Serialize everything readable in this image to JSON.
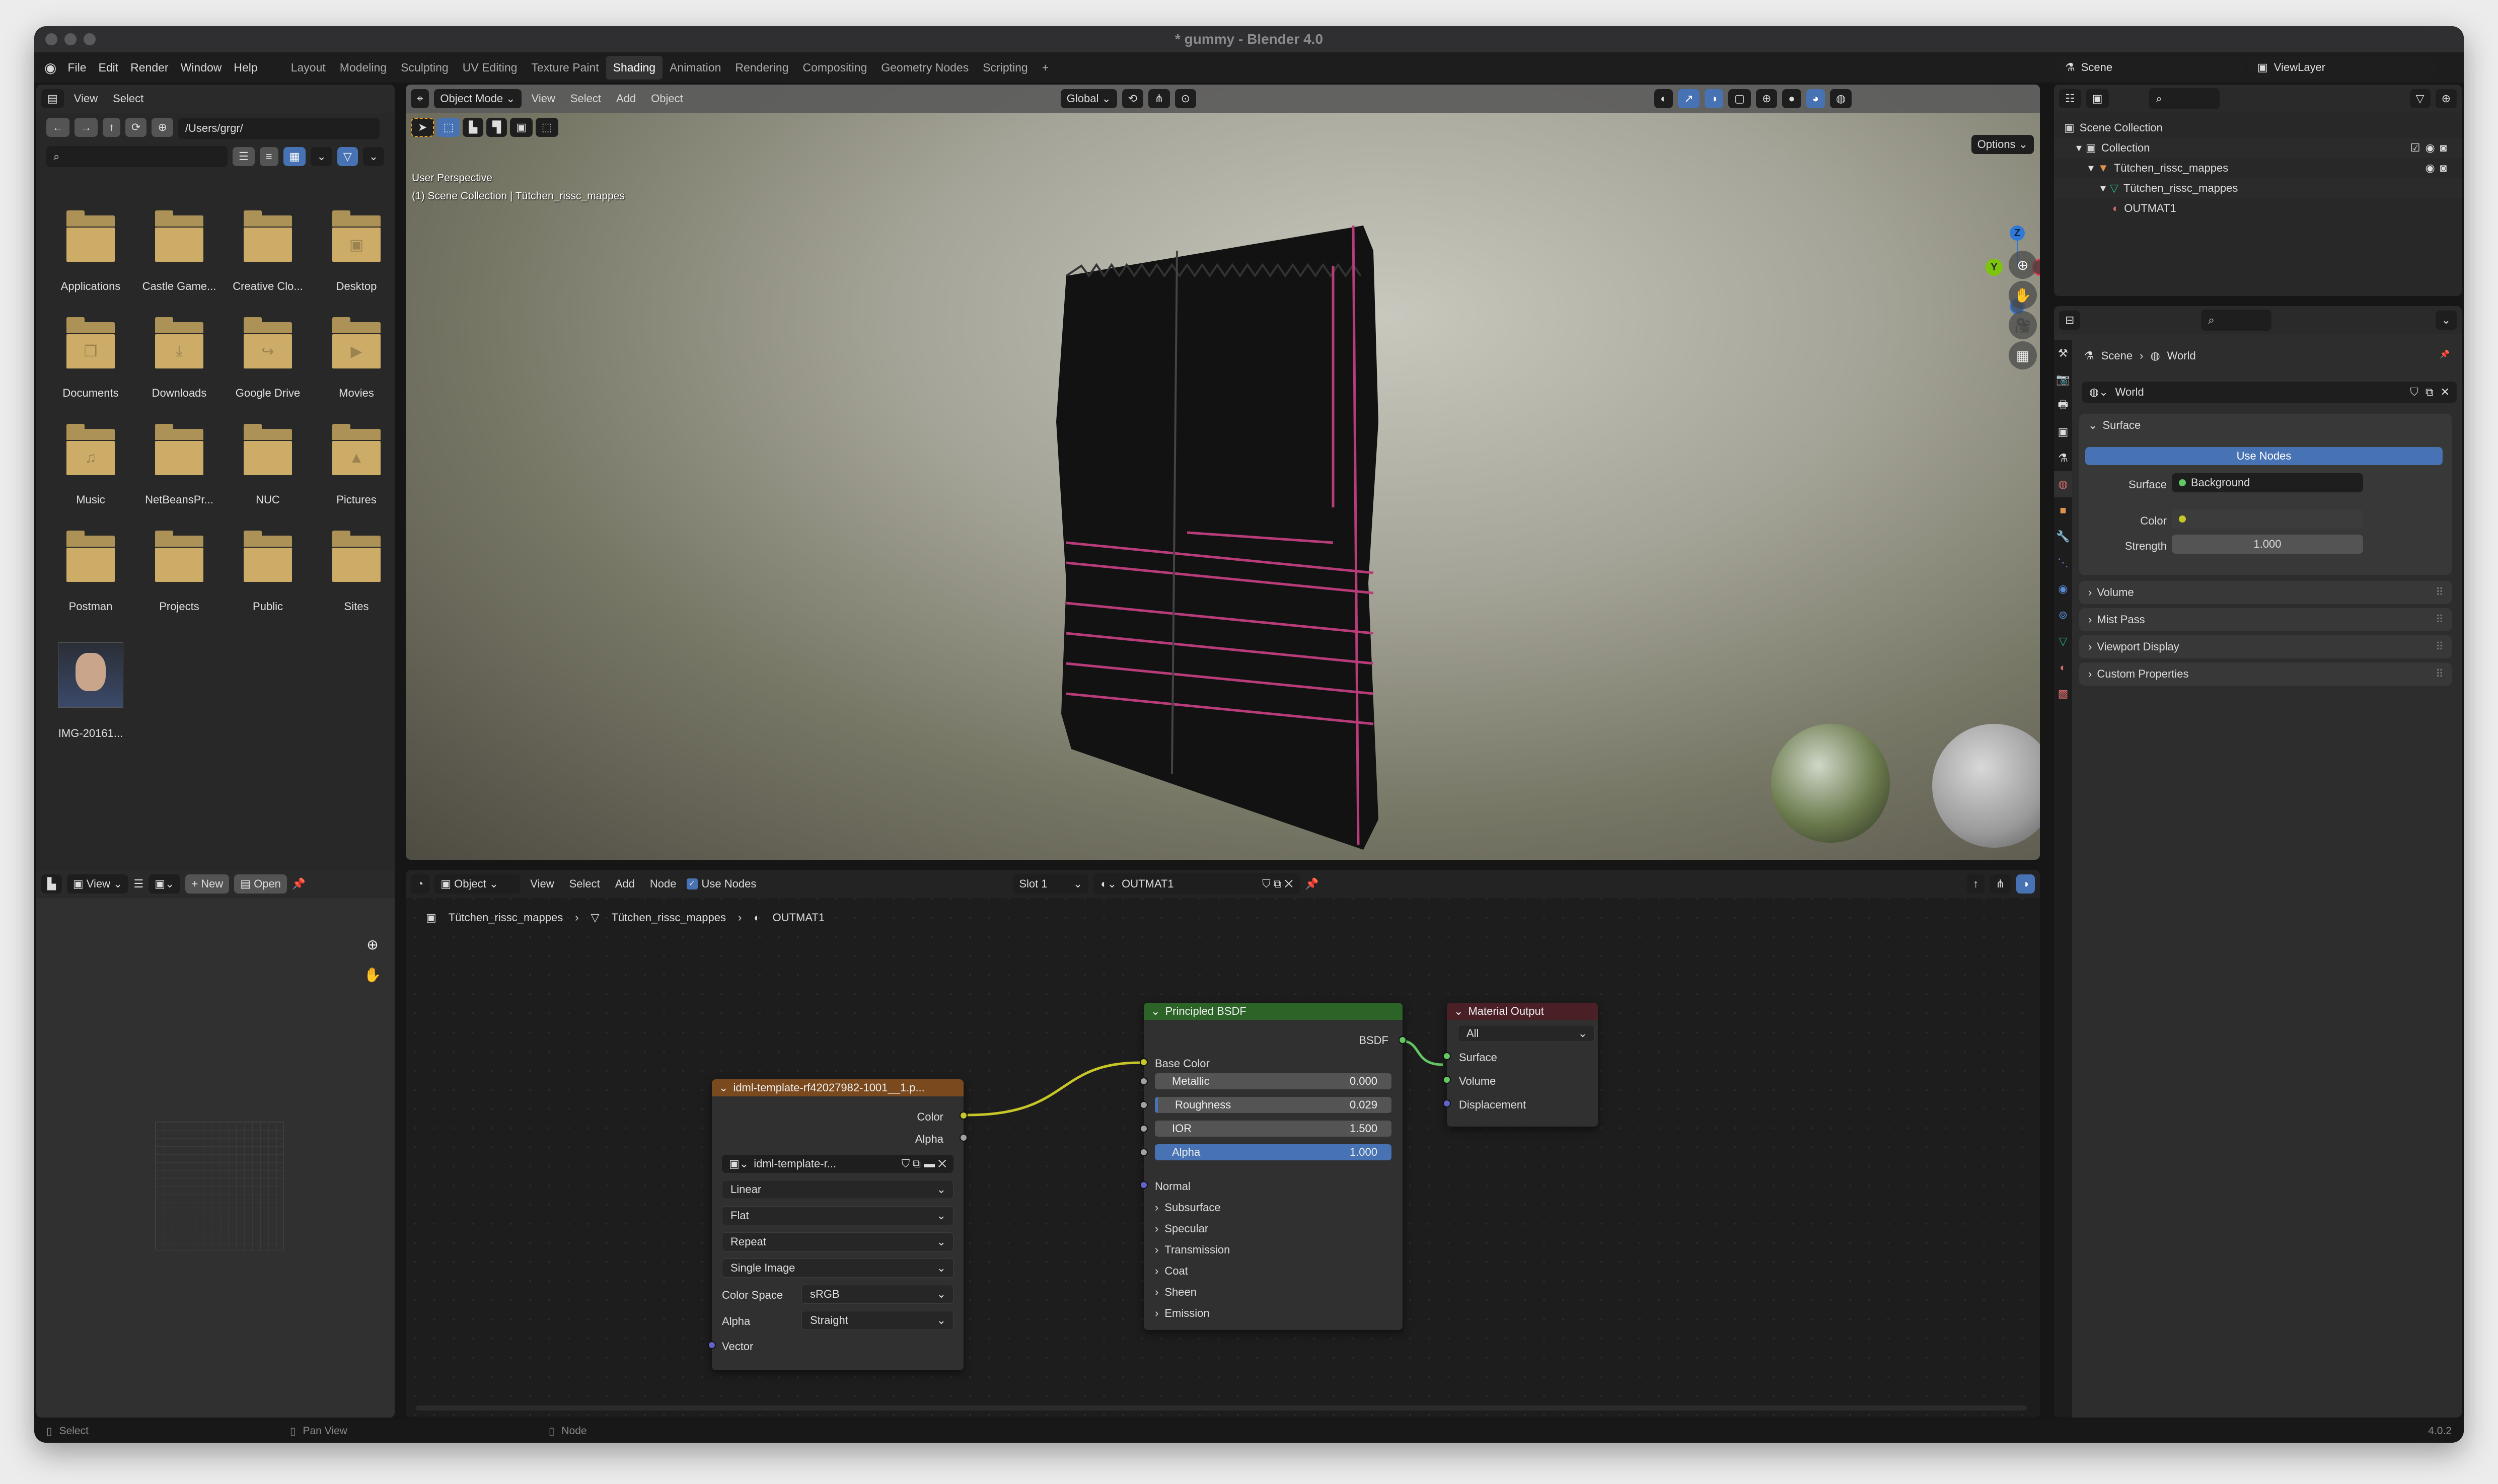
{
  "window": {
    "title": "* gummy - Blender 4.0"
  },
  "menubar": {
    "items": [
      "File",
      "Edit",
      "Render",
      "Window",
      "Help"
    ],
    "workspaces": [
      "Layout",
      "Modeling",
      "Sculpting",
      "UV Editing",
      "Texture Paint",
      "Shading",
      "Animation",
      "Rendering",
      "Compositing",
      "Geometry Nodes",
      "Scripting"
    ],
    "active_workspace": "Shading",
    "add_tab": "+"
  },
  "file_browser": {
    "menus": [
      "View",
      "Select"
    ],
    "path": "/Users/grgr/",
    "search_placeholder": "",
    "items": [
      {
        "name": "Applications",
        "icon": "folder-icon"
      },
      {
        "name": "Castle Game...",
        "icon": "folder-icon"
      },
      {
        "name": "Creative Clo...",
        "icon": "folder-icon"
      },
      {
        "name": "Desktop",
        "icon": "folder-desktop-icon"
      },
      {
        "name": "Documents",
        "icon": "folder-documents-icon"
      },
      {
        "name": "Downloads",
        "icon": "folder-download-icon"
      },
      {
        "name": "Google Drive",
        "icon": "folder-link-icon"
      },
      {
        "name": "Movies",
        "icon": "folder-movies-icon"
      },
      {
        "name": "Music",
        "icon": "folder-music-icon"
      },
      {
        "name": "NetBeansPr...",
        "icon": "folder-icon"
      },
      {
        "name": "NUC",
        "icon": "folder-icon"
      },
      {
        "name": "Pictures",
        "icon": "folder-pictures-icon"
      },
      {
        "name": "Postman",
        "icon": "folder-icon"
      },
      {
        "name": "Projects",
        "icon": "folder-icon"
      },
      {
        "name": "Public",
        "icon": "folder-icon"
      },
      {
        "name": "Sites",
        "icon": "folder-icon"
      },
      {
        "name": "IMG-20161...",
        "icon": "image-thumbnail"
      }
    ]
  },
  "viewport": {
    "mode": "Object Mode",
    "menus": [
      "View",
      "Select",
      "Add",
      "Object"
    ],
    "orientation": "Global",
    "options": "Options",
    "overlay_text": [
      "User Perspective",
      "(1) Scene Collection | Tütchen_rissc_mappes"
    ],
    "gizmo": {
      "z": "Z",
      "y": "Y"
    }
  },
  "topbar_right": {
    "scene": "Scene",
    "view_layer": "ViewLayer"
  },
  "outliner": {
    "rows": [
      {
        "label": "Scene Collection",
        "icon": "scene-collection-icon",
        "depth": 0
      },
      {
        "label": "Collection",
        "icon": "collection-icon",
        "depth": 1
      },
      {
        "label": "Tütchen_rissc_mappes",
        "icon": "object-mesh-icon",
        "depth": 2
      },
      {
        "label": "Tütchen_rissc_mappes",
        "icon": "mesh-data-icon",
        "depth": 3
      },
      {
        "label": "OUTMAT1",
        "icon": "material-icon",
        "depth": 4
      }
    ]
  },
  "properties": {
    "breadcrumb": [
      "Scene",
      "World"
    ],
    "world_name": "World",
    "surface_panel": {
      "title": "Surface",
      "use_nodes": "Use Nodes",
      "surface_label": "Surface",
      "surface_value": "Background",
      "color_label": "Color",
      "strength_label": "Strength",
      "strength_value": "1.000"
    },
    "collapsed_panels": [
      "Volume",
      "Mist Pass",
      "Viewport Display",
      "Custom Properties"
    ]
  },
  "image_editor": {
    "menus": [
      "View"
    ],
    "new": "New",
    "open": "Open"
  },
  "node_editor": {
    "object_label": "Object",
    "menus": [
      "View",
      "Select",
      "Add",
      "Node"
    ],
    "use_nodes": "Use Nodes",
    "slot": "Slot 1",
    "material": "OUTMAT1",
    "breadcrumb": [
      "Tütchen_rissc_mappes",
      "Tütchen_rissc_mappes",
      "OUTMAT1"
    ],
    "image_node": {
      "title": "idml-template-rf42027982-1001__1.p...",
      "outputs": [
        "Color",
        "Alpha"
      ],
      "image": "idml-template-r...",
      "dropdowns": [
        "Linear",
        "Flat",
        "Repeat",
        "Single Image"
      ],
      "color_space_label": "Color Space",
      "color_space": "sRGB",
      "alpha_label": "Alpha",
      "alpha": "Straight",
      "input": "Vector"
    },
    "bsdf_node": {
      "title": "Principled BSDF",
      "output": "BSDF",
      "base_color": "Base Color",
      "fields": [
        {
          "label": "Metallic",
          "value": "0.000"
        },
        {
          "label": "Roughness",
          "value": "0.029"
        },
        {
          "label": "IOR",
          "value": "1.500"
        },
        {
          "label": "Alpha",
          "value": "1.000"
        }
      ],
      "normal": "Normal",
      "sections": [
        "Subsurface",
        "Specular",
        "Transmission",
        "Coat",
        "Sheen",
        "Emission"
      ]
    },
    "output_node": {
      "title": "Material Output",
      "target": "All",
      "inputs": [
        "Surface",
        "Volume",
        "Displacement"
      ]
    }
  },
  "statusbar": {
    "items": [
      "Select",
      "Pan View",
      "Node"
    ],
    "version": "4.0.2"
  },
  "colors": {
    "accent": "#4772b3",
    "folder": "#ccac67",
    "image_node_header": "#7a4a1e",
    "bsdf_header": "#2c6428",
    "output_header": "#4a1f26",
    "socket_color": "#c7c729",
    "socket_shader": "#63c763",
    "socket_vector": "#6363c7",
    "socket_float": "#a1a1a1"
  }
}
